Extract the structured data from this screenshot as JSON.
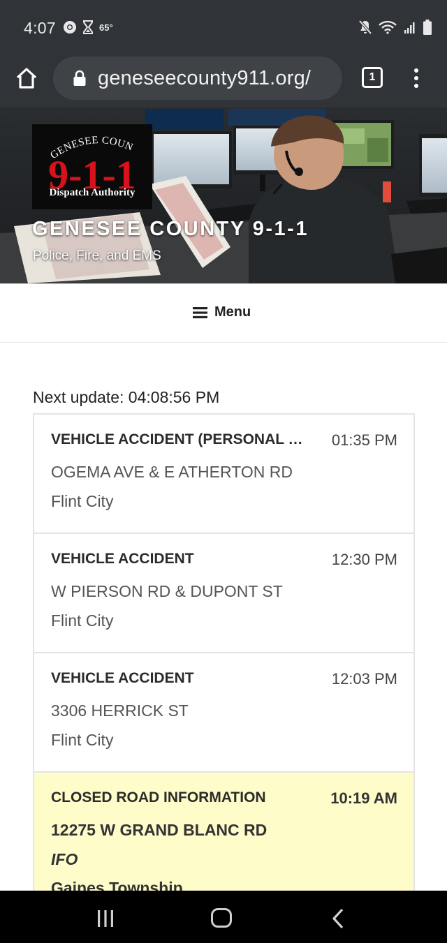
{
  "status_bar": {
    "time": "4:07",
    "temperature": "65°",
    "left_icons": [
      "chrome-icon",
      "hourglass-icon"
    ],
    "right_icons": [
      "mute-icon",
      "wifi-icon",
      "signal-icon",
      "battery-icon"
    ]
  },
  "browser": {
    "url": "geneseecounty911.org/",
    "tab_count": "1"
  },
  "banner": {
    "logo": {
      "arc_text": "GENESEE COUNTY",
      "number": "9-1-1",
      "subtitle": "Dispatch Authority"
    },
    "site_title": "GENESEE COUNTY 9-1-1",
    "tagline": "Police, Fire, and EMS"
  },
  "menu": {
    "label": "Menu"
  },
  "feed": {
    "next_update": "Next update: 04:08:56 PM",
    "incidents": [
      {
        "type": "VEHICLE ACCIDENT (PERSONAL INJURY)",
        "time": "01:35 PM",
        "address": "OGEMA AVE & E ATHERTON RD",
        "city": "Flint City"
      },
      {
        "type": "VEHICLE ACCIDENT",
        "time": "12:30 PM",
        "address": "W PIERSON RD & DUPONT ST",
        "city": "Flint City"
      },
      {
        "type": "VEHICLE ACCIDENT",
        "time": "12:03 PM",
        "address": "3306 HERRICK ST",
        "city": "Flint City"
      },
      {
        "type": "CLOSED ROAD INFORMATION",
        "time": "10:19 AM",
        "address": "12275 W GRAND BLANC RD",
        "note": "IFO",
        "city": "Gaines Township",
        "highlight_color": "#fefcc9"
      }
    ]
  },
  "colors": {
    "system_bar": "#303337",
    "url_field": "#3f4246",
    "logo_red": "#d8121a",
    "closed_road_bg": "#fefcc9"
  }
}
